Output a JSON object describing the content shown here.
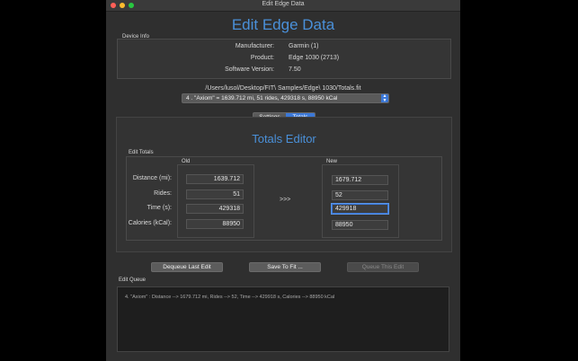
{
  "window": {
    "title": "Edit Edge Data"
  },
  "header": {
    "title": "Edit Edge Data"
  },
  "device_info": {
    "label": "Device Info",
    "manufacturer_label": "Manufacturer:",
    "manufacturer_value": "Garmin (1)",
    "product_label": "Product:",
    "product_value": "Edge 1030 (2713)",
    "software_label": "Software Version:",
    "software_value": "7.50"
  },
  "file_path": "/Users/lusol/Desktop/FIT\\ Samples/Edge\\ 1030/Totals.fit",
  "record_select": {
    "value": "4 . \"Axiom\" = 1639.712 mi, 51 rides, 429318 s, 88950 kCal"
  },
  "tabs": {
    "settings": "Settings",
    "totals": "Totals",
    "selected": "Totals"
  },
  "totals_editor": {
    "title": "Totals Editor",
    "group_label": "Edit Totals",
    "old_label": "Old",
    "new_label": "New",
    "arrow": ">>>",
    "rows": [
      {
        "label": "Distance (mi):",
        "old": "1639.712",
        "new": "1679.712"
      },
      {
        "label": "Rides:",
        "old": "51",
        "new": "52"
      },
      {
        "label": "Time (s):",
        "old": "429318",
        "new": "429918"
      },
      {
        "label": "Calories (kCal):",
        "old": "88950",
        "new": "88950"
      }
    ]
  },
  "buttons": {
    "dequeue": "Dequeue Last Edit",
    "save": "Save To Fit ...",
    "queue": "Queue This Edit"
  },
  "edit_queue": {
    "label": "Edit Queue",
    "items": [
      "4. \"Axiom\" : Distance --> 1679.712 mi, Rides --> 52, Time --> 429918 s, Calories --> 88950 kCal"
    ]
  }
}
